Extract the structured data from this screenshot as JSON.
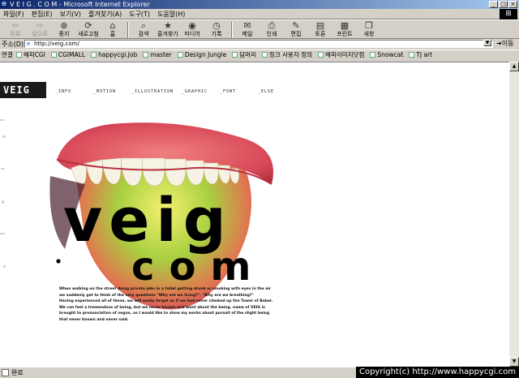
{
  "window": {
    "title": "V E I G . C O M - Microsoft Internet Explorer",
    "minimize": "_",
    "maximize": "□",
    "close": "×"
  },
  "menu": [
    "파일(F)",
    "편집(E)",
    "보기(V)",
    "즐겨찾기(A)",
    "도구(T)",
    "도움말(H)"
  ],
  "toolbar": {
    "back": "뒤로",
    "forward": "앞으로",
    "stop": "중지",
    "refresh": "새로고침",
    "home": "홈",
    "search": "검색",
    "favorites": "즐겨찾기",
    "media": "미디어",
    "history": "기록",
    "mail": "메일",
    "print": "인쇄",
    "edit": "편집",
    "discuss": "토론",
    "print_label": "프린트",
    "messenger": "새창"
  },
  "address": {
    "label": "주소(D)",
    "url": "http://veig.com/",
    "go": "이동"
  },
  "links": {
    "label": "연결",
    "items": [
      "해피CGI",
      "CGIMALL",
      "happycgi.Job",
      "master",
      "Design Jungle",
      "담머리",
      "링크 사용자 정의",
      "해피이미지닷컴",
      "Snowcat",
      "TJ art"
    ]
  },
  "page": {
    "logo": "VEIG",
    "nav": [
      "_INFO",
      "_MOTION",
      "_ILLUSTRATION",
      "_GRAPHIC",
      "_FONT",
      "_ELSE"
    ],
    "big_word_top": "veig",
    "big_word_bottom": "com",
    "story": [
      "When walking on the street doing private jobs in a toilet getting drunk or smoking with eyes in the air",
      "we suddenly get to think of the very questions \"Why are we living?\", \"Why are we breathing?\"",
      "Having experienced all of these, we will easily forget as if we had never climbed up the Tower of Babel.",
      "We can feel a tremendous of being, but we never known and want about the being. name of VEIG is",
      "brought to pronunciation of vegan, so I would like to show my works about pursuit of the slight being",
      "that never known and never said."
    ]
  },
  "status": {
    "text": "완료",
    "copyright": "Copyright(c) http://www.happycgi.com"
  }
}
